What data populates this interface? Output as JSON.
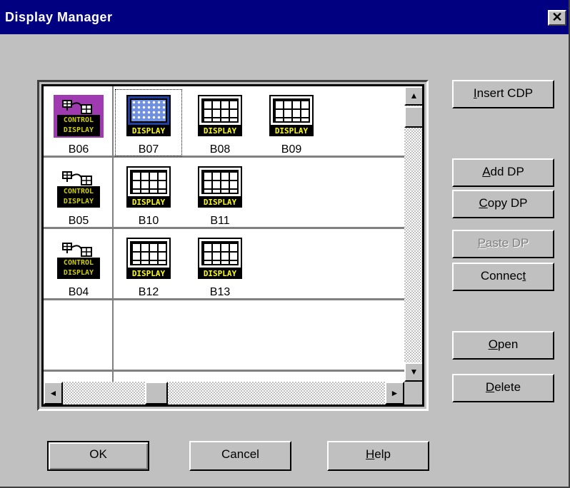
{
  "window": {
    "title": "Display Manager",
    "close_glyph": "✕"
  },
  "grid": {
    "rows": [
      {
        "cdp": {
          "label": "B06",
          "icon": "control-display-icon",
          "text1": "CONTROL",
          "text2": "DISPLAY",
          "selected_style": true
        },
        "displays": [
          {
            "label": "B07",
            "icon": "display-icon",
            "text": "DISPLAY",
            "highlighted": true
          },
          {
            "label": "B08",
            "icon": "display-icon",
            "text": "DISPLAY"
          },
          {
            "label": "B09",
            "icon": "display-icon",
            "text": "DISPLAY"
          }
        ]
      },
      {
        "cdp": {
          "label": "B05",
          "icon": "control-display-icon",
          "text1": "CONTROL",
          "text2": "DISPLAY"
        },
        "displays": [
          {
            "label": "B10",
            "icon": "display-icon",
            "text": "DISPLAY"
          },
          {
            "label": "B11",
            "icon": "display-icon",
            "text": "DISPLAY"
          }
        ]
      },
      {
        "cdp": {
          "label": "B04",
          "icon": "control-display-icon",
          "text1": "CONTROL",
          "text2": "DISPLAY"
        },
        "displays": [
          {
            "label": "B12",
            "icon": "display-icon",
            "text": "DISPLAY"
          },
          {
            "label": "B13",
            "icon": "display-icon",
            "text": "DISPLAY"
          }
        ]
      }
    ]
  },
  "side_buttons": {
    "insert_cdp": {
      "pre": "",
      "u": "I",
      "post": "nsert CDP"
    },
    "add_dp": {
      "pre": "",
      "u": "A",
      "post": "dd DP"
    },
    "copy_dp": {
      "pre": "",
      "u": "C",
      "post": "opy DP"
    },
    "paste_dp": {
      "pre": "",
      "u": "P",
      "post": "aste DP",
      "disabled": true
    },
    "connect": {
      "pre": "Connec",
      "u": "t",
      "post": ""
    },
    "open": {
      "pre": "",
      "u": "O",
      "post": "pen"
    },
    "delete": {
      "pre": "",
      "u": "D",
      "post": "elete"
    }
  },
  "bottom_buttons": {
    "ok": "OK",
    "cancel": "Cancel",
    "help": {
      "pre": "",
      "u": "H",
      "post": "elp"
    }
  },
  "scroll_glyphs": {
    "up": "▲",
    "down": "▼",
    "left": "◄",
    "right": "►"
  }
}
